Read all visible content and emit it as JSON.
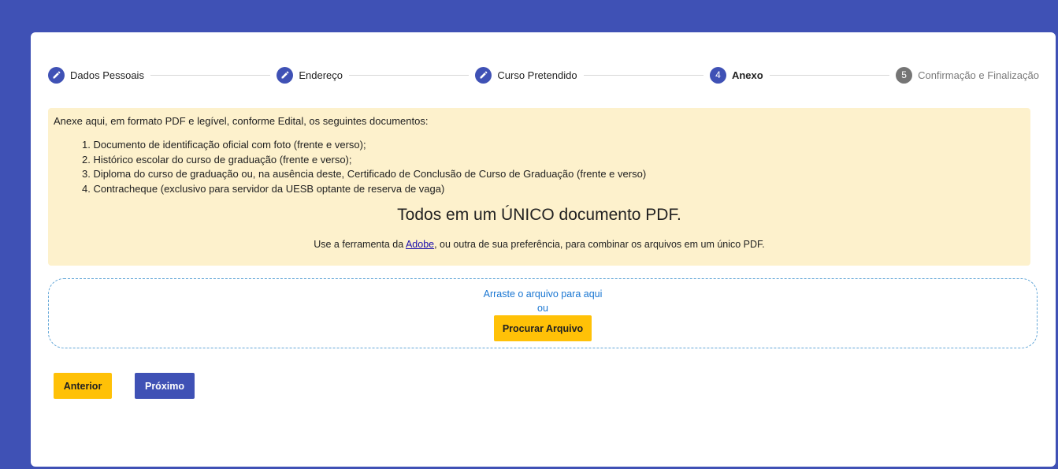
{
  "stepper": {
    "steps": [
      {
        "label": "Dados Pessoais",
        "state": "completed",
        "icon": "pencil-icon"
      },
      {
        "label": "Endereço",
        "state": "completed",
        "icon": "pencil-icon"
      },
      {
        "label": "Curso Pretendido",
        "state": "completed",
        "icon": "pencil-icon"
      },
      {
        "label": "Anexo",
        "state": "active",
        "number": "4"
      },
      {
        "label": "Confirmação e Finalização",
        "state": "inactive",
        "number": "5"
      }
    ]
  },
  "info": {
    "intro": "Anexe aqui, em formato PDF e legível, conforme Edital, os seguintes documentos:",
    "items": [
      "1. Documento de identificação oficial com foto (frente e verso);",
      "2. Histórico escolar do curso de graduação (frente e verso);",
      "3. Diploma do curso de graduação ou, na ausência deste, Certificado de Conclusão de Curso de Graduação (frente e verso)",
      "4. Contracheque (exclusivo para servidor da UESB optante de reserva de vaga)"
    ],
    "headline": "Todos em um ÚNICO documento PDF.",
    "hint_before": "Use a ferramenta da ",
    "hint_link": "Adobe",
    "hint_after": ", ou outra de sua preferência, para combinar os arquivos em um único PDF."
  },
  "upload": {
    "drag_text": "Arraste o arquivo para aqui",
    "or_text": "ou",
    "browse_label": "Procurar Arquivo"
  },
  "nav": {
    "prev_label": "Anterior",
    "next_label": "Próximo"
  },
  "colors": {
    "background": "#3f51b5",
    "primary": "#3f51b5",
    "accent": "#ffc107",
    "info_bg": "#fdf1cc",
    "inactive_step": "#757575",
    "link": "#1a0dab",
    "drop_text": "#1976d2"
  }
}
